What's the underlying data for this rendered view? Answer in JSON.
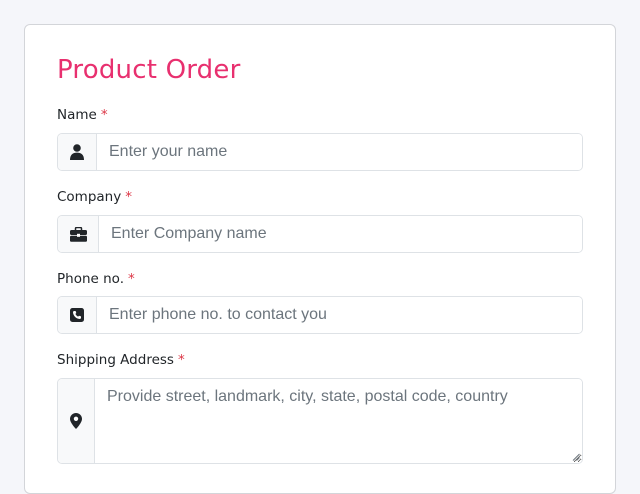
{
  "form": {
    "title": "Product Order",
    "required_marker": "*",
    "fields": [
      {
        "label": "Name",
        "placeholder": "Enter your name",
        "value": "",
        "icon": "user-icon"
      },
      {
        "label": "Company",
        "placeholder": "Enter Company name",
        "value": "",
        "icon": "briefcase-icon"
      },
      {
        "label": "Phone no.",
        "placeholder": "Enter phone no. to contact you",
        "value": "",
        "icon": "phone-icon"
      },
      {
        "label": "Shipping Address",
        "placeholder": "Provide street, landmark, city, state, postal code, country",
        "value": "",
        "icon": "map-pin-icon"
      }
    ]
  },
  "colors": {
    "title": "#e8306f",
    "required": "#dc3545",
    "background": "#f5f6fa",
    "addon_background": "#f8f9fa"
  }
}
